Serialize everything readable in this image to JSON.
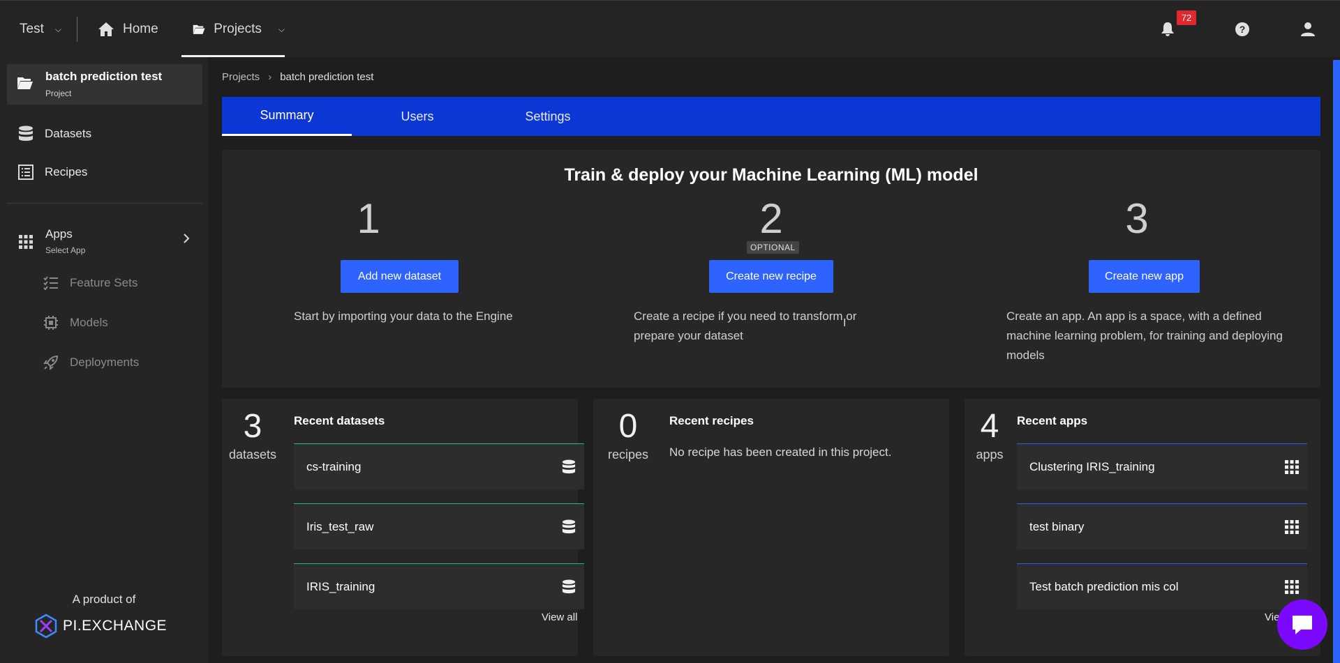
{
  "topbar": {
    "workspace": "Test",
    "home": "Home",
    "projects": "Projects",
    "notification_count": "72"
  },
  "sidebar": {
    "project_name": "batch prediction test",
    "project_sub": "Project",
    "datasets": "Datasets",
    "recipes": "Recipes",
    "apps": "Apps",
    "apps_sub": "Select App",
    "feature_sets": "Feature Sets",
    "models": "Models",
    "deployments": "Deployments",
    "product_of": "A product of",
    "brand": "PI.EXCHANGE"
  },
  "breadcrumb": {
    "root": "Projects",
    "current": "batch prediction test"
  },
  "tabs": [
    "Summary",
    "Users",
    "Settings"
  ],
  "hero": {
    "title": "Train & deploy your Machine Learning (ML) model",
    "steps": [
      {
        "num": "1",
        "button": "Add new dataset",
        "desc": "Start by importing your data to the Engine"
      },
      {
        "num": "2",
        "button": "Create new recipe",
        "desc": "Create a recipe if you need to transform or prepare your dataset",
        "tag": "OPTIONAL"
      },
      {
        "num": "3",
        "button": "Create new app",
        "desc": "Create an app. An app is a space, with a defined machine learning problem, for training and deploying models"
      }
    ]
  },
  "cards": {
    "datasets": {
      "count": "3",
      "unit": "datasets",
      "title": "Recent datasets",
      "items": [
        "cs-training",
        "Iris_test_raw",
        "IRIS_training"
      ],
      "view_all": "View all"
    },
    "recipes": {
      "count": "0",
      "unit": "recipes",
      "title": "Recent recipes",
      "empty": "No recipe has been created in this project."
    },
    "apps": {
      "count": "4",
      "unit": "apps",
      "title": "Recent apps",
      "items": [
        "Clustering IRIS_training",
        "test binary",
        "Test batch prediction mis col"
      ],
      "view_all": "Vie"
    }
  },
  "colors": {
    "accent": "#2f63ff",
    "tabbar": "#0d37d4",
    "badge": "#e0282e",
    "chat": "#7b08ff",
    "dataset_line": "#2ab2a0",
    "app_line": "#3b56e8"
  }
}
